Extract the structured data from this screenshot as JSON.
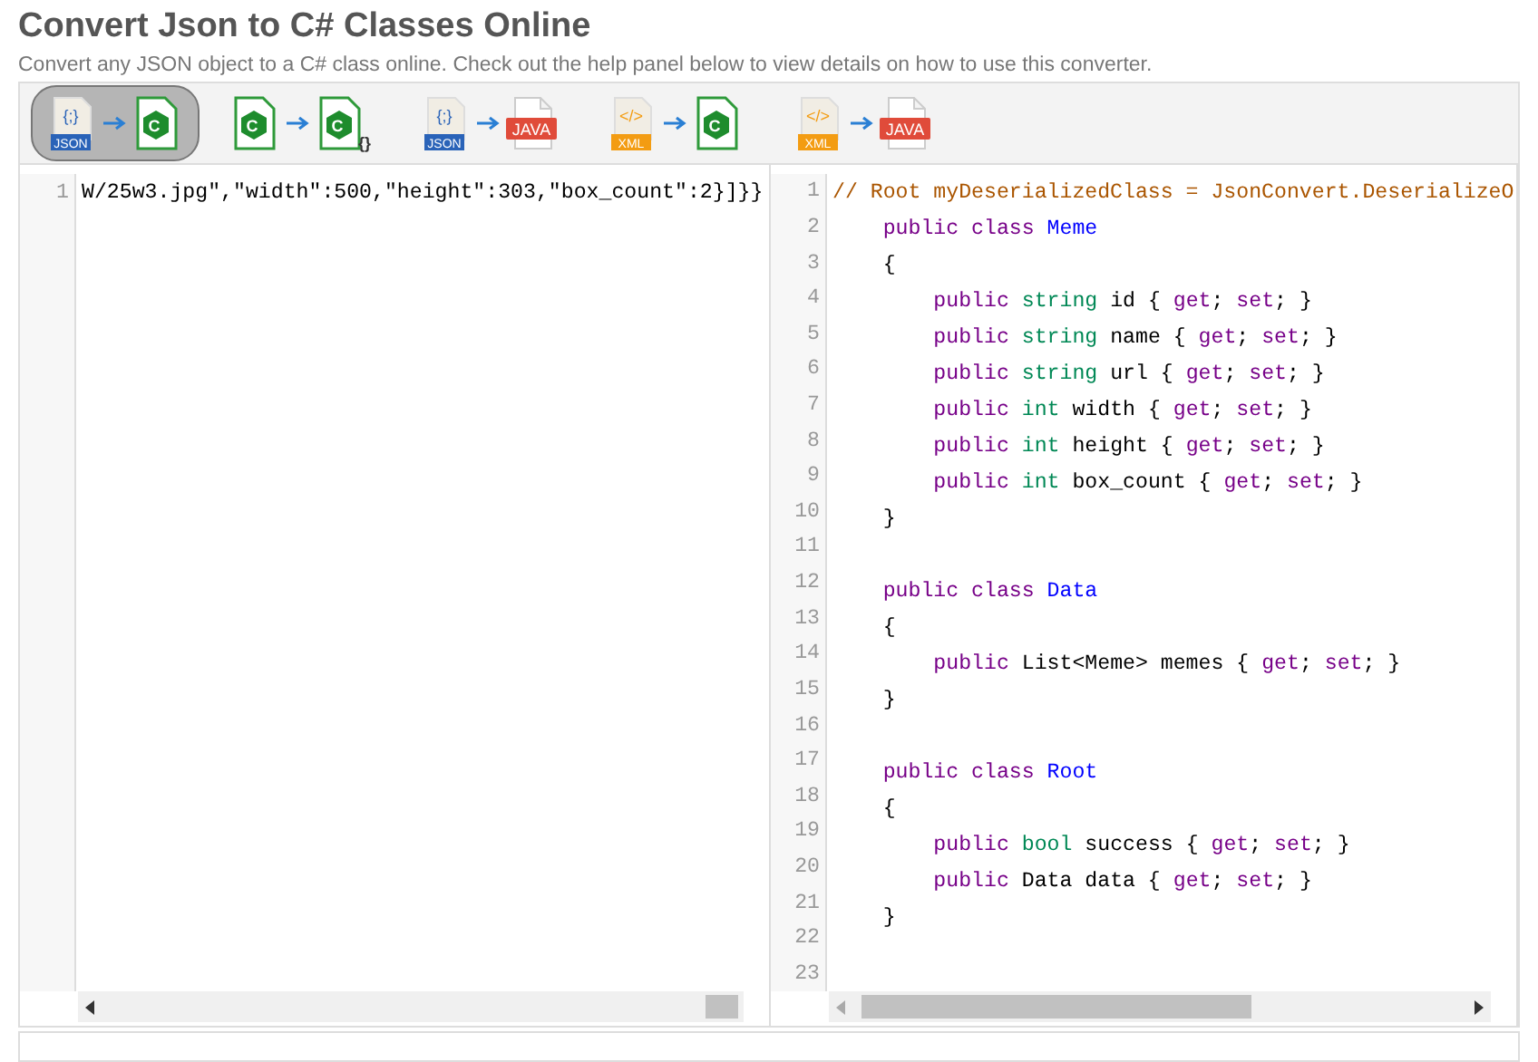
{
  "page": {
    "title": "Convert Json to C# Classes Online",
    "subtitle": "Convert any JSON object to a C# class online. Check out the help panel below to view details on how to use this converter."
  },
  "converters": [
    {
      "selected": true,
      "from": {
        "kind": "json",
        "glyph": "{;}",
        "label": "JSON"
      },
      "to": {
        "kind": "csharp",
        "glyph": "C"
      }
    },
    {
      "selected": false,
      "from": {
        "kind": "csharp",
        "glyph": "C"
      },
      "to": {
        "kind": "csharp-json",
        "glyph": "C",
        "extra": "{}"
      }
    },
    {
      "selected": false,
      "from": {
        "kind": "json",
        "glyph": "{;}",
        "label": "JSON"
      },
      "to": {
        "kind": "java",
        "label": "JAVA"
      }
    },
    {
      "selected": false,
      "from": {
        "kind": "xml",
        "glyph": "</>",
        "label": "XML"
      },
      "to": {
        "kind": "csharp",
        "glyph": "C"
      }
    },
    {
      "selected": false,
      "from": {
        "kind": "xml",
        "glyph": "</>",
        "label": "XML"
      },
      "to": {
        "kind": "java",
        "label": "JAVA"
      }
    }
  ],
  "input_editor": {
    "lines": [
      {
        "number": "1",
        "tokens": [
          {
            "kind": "plain",
            "text": "W/25w3.jpg\",\"width\":500,\"height\":303,\"box_count\":2}]}}"
          }
        ]
      }
    ]
  },
  "output_editor": {
    "lines": [
      {
        "number": "1",
        "tokens": [
          {
            "kind": "comment",
            "text": "// Root myDeserializedClass = JsonConvert.DeserializeO"
          }
        ]
      },
      {
        "number": "2",
        "tokens": [
          {
            "kind": "keyword",
            "text": "    public class"
          },
          {
            "kind": "def",
            "text": " Meme"
          }
        ]
      },
      {
        "number": "3",
        "tokens": [
          {
            "kind": "plain",
            "text": "    {"
          }
        ]
      },
      {
        "number": "4",
        "tokens": [
          {
            "kind": "keyword",
            "text": "        public"
          },
          {
            "kind": "type",
            "text": " string"
          },
          {
            "kind": "plain",
            "text": " id { "
          },
          {
            "kind": "keyword",
            "text": "get"
          },
          {
            "kind": "plain",
            "text": "; "
          },
          {
            "kind": "keyword",
            "text": "set"
          },
          {
            "kind": "plain",
            "text": "; }"
          }
        ]
      },
      {
        "number": "5",
        "tokens": [
          {
            "kind": "keyword",
            "text": "        public"
          },
          {
            "kind": "type",
            "text": " string"
          },
          {
            "kind": "plain",
            "text": " name { "
          },
          {
            "kind": "keyword",
            "text": "get"
          },
          {
            "kind": "plain",
            "text": "; "
          },
          {
            "kind": "keyword",
            "text": "set"
          },
          {
            "kind": "plain",
            "text": "; }"
          }
        ]
      },
      {
        "number": "6",
        "tokens": [
          {
            "kind": "keyword",
            "text": "        public"
          },
          {
            "kind": "type",
            "text": " string"
          },
          {
            "kind": "plain",
            "text": " url { "
          },
          {
            "kind": "keyword",
            "text": "get"
          },
          {
            "kind": "plain",
            "text": "; "
          },
          {
            "kind": "keyword",
            "text": "set"
          },
          {
            "kind": "plain",
            "text": "; }"
          }
        ]
      },
      {
        "number": "7",
        "tokens": [
          {
            "kind": "keyword",
            "text": "        public"
          },
          {
            "kind": "type",
            "text": " int"
          },
          {
            "kind": "plain",
            "text": " width { "
          },
          {
            "kind": "keyword",
            "text": "get"
          },
          {
            "kind": "plain",
            "text": "; "
          },
          {
            "kind": "keyword",
            "text": "set"
          },
          {
            "kind": "plain",
            "text": "; }"
          }
        ]
      },
      {
        "number": "8",
        "tokens": [
          {
            "kind": "keyword",
            "text": "        public"
          },
          {
            "kind": "type",
            "text": " int"
          },
          {
            "kind": "plain",
            "text": " height { "
          },
          {
            "kind": "keyword",
            "text": "get"
          },
          {
            "kind": "plain",
            "text": "; "
          },
          {
            "kind": "keyword",
            "text": "set"
          },
          {
            "kind": "plain",
            "text": "; }"
          }
        ]
      },
      {
        "number": "9",
        "tokens": [
          {
            "kind": "keyword",
            "text": "        public"
          },
          {
            "kind": "type",
            "text": " int"
          },
          {
            "kind": "plain",
            "text": " box_count { "
          },
          {
            "kind": "keyword",
            "text": "get"
          },
          {
            "kind": "plain",
            "text": "; "
          },
          {
            "kind": "keyword",
            "text": "set"
          },
          {
            "kind": "plain",
            "text": "; }"
          }
        ]
      },
      {
        "number": "10",
        "tokens": [
          {
            "kind": "plain",
            "text": "    }"
          }
        ]
      },
      {
        "number": "11"
      },
      {
        "number": "12",
        "tokens": [
          {
            "kind": "keyword",
            "text": "    public class"
          },
          {
            "kind": "def",
            "text": " Data"
          }
        ]
      },
      {
        "number": "13",
        "tokens": [
          {
            "kind": "plain",
            "text": "    {"
          }
        ]
      },
      {
        "number": "14",
        "tokens": [
          {
            "kind": "keyword",
            "text": "        public"
          },
          {
            "kind": "plain",
            "text": " List<Meme> memes { "
          },
          {
            "kind": "keyword",
            "text": "get"
          },
          {
            "kind": "plain",
            "text": "; "
          },
          {
            "kind": "keyword",
            "text": "set"
          },
          {
            "kind": "plain",
            "text": "; }"
          }
        ]
      },
      {
        "number": "15",
        "tokens": [
          {
            "kind": "plain",
            "text": "    }"
          }
        ]
      },
      {
        "number": "16"
      },
      {
        "number": "17",
        "tokens": [
          {
            "kind": "keyword",
            "text": "    public class"
          },
          {
            "kind": "def",
            "text": " Root"
          }
        ]
      },
      {
        "number": "18",
        "tokens": [
          {
            "kind": "plain",
            "text": "    {"
          }
        ]
      },
      {
        "number": "19",
        "tokens": [
          {
            "kind": "keyword",
            "text": "        public"
          },
          {
            "kind": "type",
            "text": " bool"
          },
          {
            "kind": "plain",
            "text": " success { "
          },
          {
            "kind": "keyword",
            "text": "get"
          },
          {
            "kind": "plain",
            "text": "; "
          },
          {
            "kind": "keyword",
            "text": "set"
          },
          {
            "kind": "plain",
            "text": "; }"
          }
        ]
      },
      {
        "number": "20",
        "tokens": [
          {
            "kind": "keyword",
            "text": "        public"
          },
          {
            "kind": "plain",
            "text": " Data data { "
          },
          {
            "kind": "keyword",
            "text": "get"
          },
          {
            "kind": "plain",
            "text": "; "
          },
          {
            "kind": "keyword",
            "text": "set"
          },
          {
            "kind": "plain",
            "text": "; }"
          }
        ]
      },
      {
        "number": "21",
        "tokens": [
          {
            "kind": "plain",
            "text": "    }"
          }
        ]
      },
      {
        "number": "22"
      },
      {
        "number": "23"
      }
    ]
  }
}
